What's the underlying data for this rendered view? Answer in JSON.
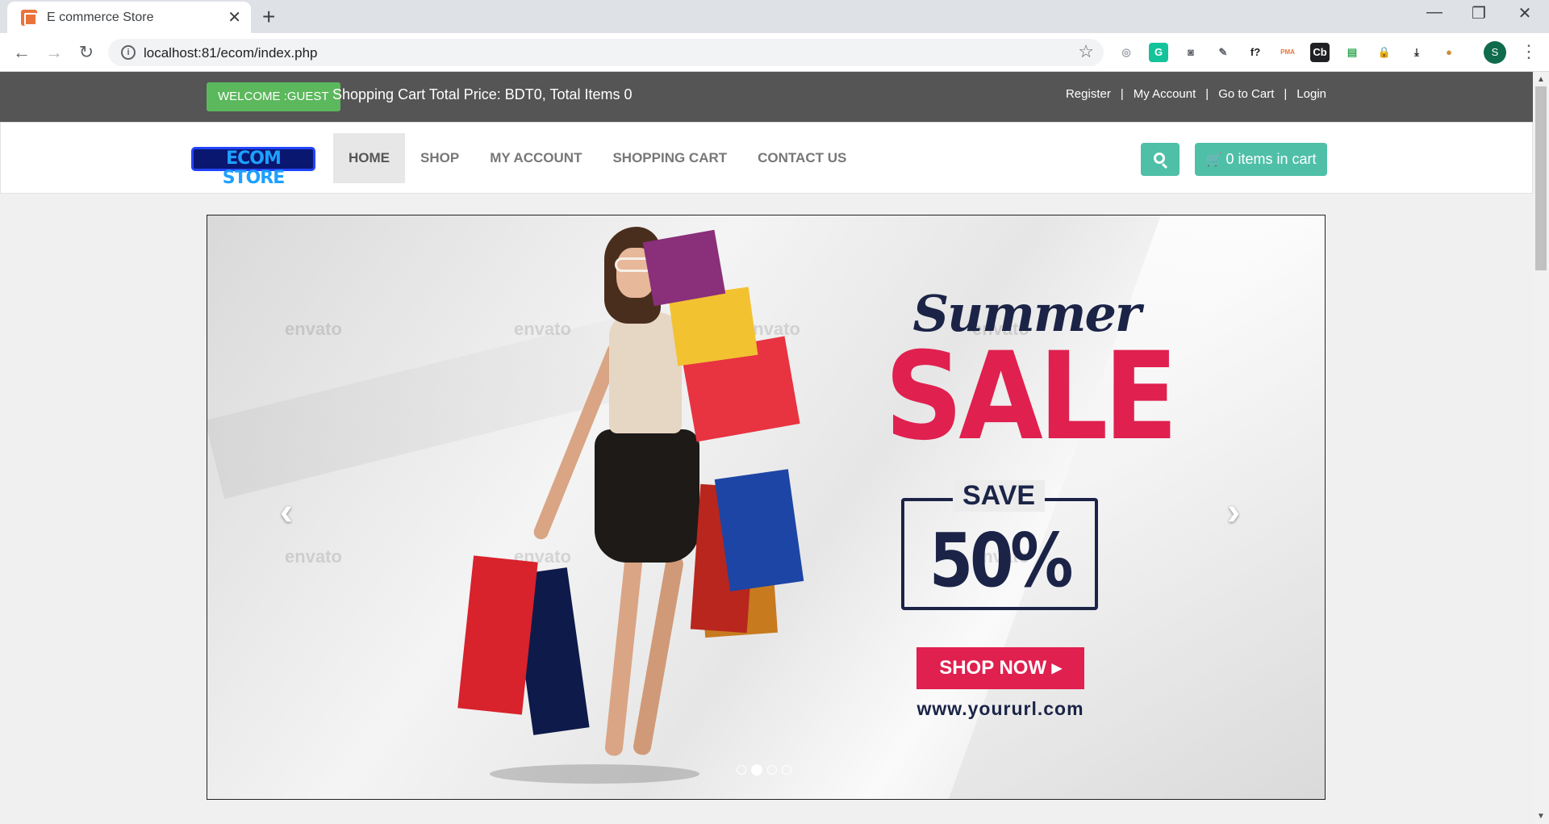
{
  "browser": {
    "tab_title": "E commerce Store",
    "url": "localhost:81/ecom/index.php",
    "new_tab": "+",
    "close_tab": "✕",
    "back": "←",
    "forward": "→",
    "reload": "↻",
    "star": "☆",
    "profile_initial": "S",
    "menu": "⋮",
    "window_controls": {
      "minimize": "—",
      "maximize": "❐",
      "close": "✕"
    },
    "extensions": [
      {
        "name": "ext-1-icon",
        "label": "◎",
        "color": "#9aa0a6",
        "bg": "transparent"
      },
      {
        "name": "grammarly-icon",
        "label": "G",
        "color": "#ffffff",
        "bg": "#15c39a"
      },
      {
        "name": "camera-icon",
        "label": "◙",
        "color": "#5f6368",
        "bg": "transparent"
      },
      {
        "name": "eyedropper-icon",
        "label": "✎",
        "color": "#5f6368",
        "bg": "transparent"
      },
      {
        "name": "function-icon",
        "label": "f?",
        "color": "#202124",
        "bg": "transparent"
      },
      {
        "name": "pma-icon",
        "label": "PMA",
        "color": "#e8743b",
        "bg": "transparent"
      },
      {
        "name": "cb-icon",
        "label": "Cb",
        "color": "#ffffff",
        "bg": "#202124"
      },
      {
        "name": "tray-icon",
        "label": "▤",
        "color": "#34a853",
        "bg": "transparent"
      },
      {
        "name": "lock-icon",
        "label": "🔒",
        "color": "#fbbc04",
        "bg": "transparent"
      },
      {
        "name": "download-icon",
        "label": "⤓",
        "color": "#202124",
        "bg": "transparent"
      },
      {
        "name": "cookie-icon",
        "label": "●",
        "color": "#c8903a",
        "bg": "transparent"
      }
    ]
  },
  "topbar": {
    "welcome": "WELCOME :GUEST",
    "cart_info": "Shopping Cart Total Price: BDT0, Total Items 0",
    "links": [
      "Register",
      "My Account",
      "Go to Cart",
      "Login"
    ],
    "separator": "|"
  },
  "nav": {
    "logo": "ECOM STORE",
    "items": [
      "HOME",
      "SHOP",
      "MY ACCOUNT",
      "SHOPPING CART",
      "CONTACT US"
    ],
    "cart_button": "0 items in cart",
    "cart_icon": "🛒"
  },
  "carousel": {
    "prev": "‹",
    "next": "›",
    "watermark": "envato",
    "headline_script": "Summer",
    "headline": "SALE",
    "save_label": "SAVE",
    "save_value": "50%",
    "cta": "SHOP NOW ▸",
    "url": "www.yoururl.com",
    "slide_count": 4,
    "active_slide": 2
  },
  "colors": {
    "topbar_bg": "#555555",
    "welcome_green": "#5cb85c",
    "teal_button": "#4fbfa8",
    "sale_pink": "#e0204f",
    "navy": "#1b2447"
  }
}
